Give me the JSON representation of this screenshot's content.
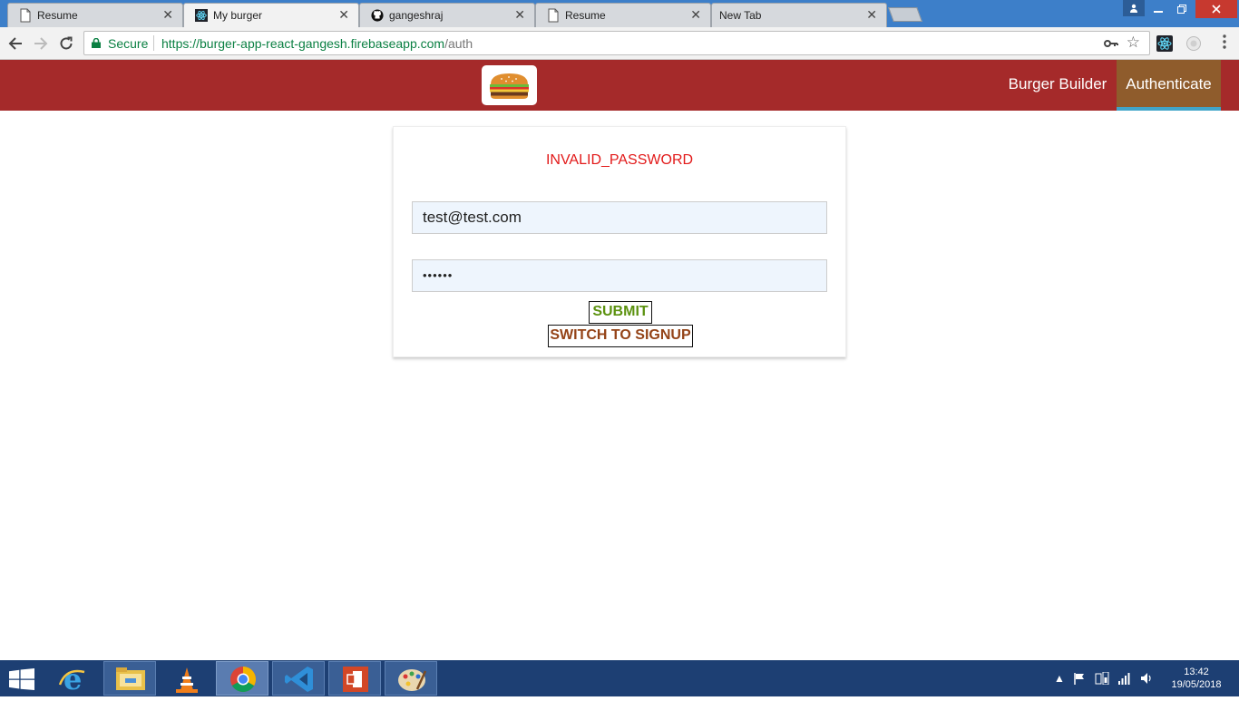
{
  "browser": {
    "tabs": [
      {
        "title": "Resume",
        "icon": "document-icon"
      },
      {
        "title": "My burger",
        "icon": "react-icon"
      },
      {
        "title": "gangeshraj",
        "icon": "github-icon"
      },
      {
        "title": "Resume",
        "icon": "document-icon"
      },
      {
        "title": "New Tab",
        "icon": ""
      }
    ],
    "active_tab": 1,
    "secure_label": "Secure",
    "url_host": "https://burger-app-react-gangesh.firebaseapp.com",
    "url_path": "/auth"
  },
  "app": {
    "nav": {
      "burger_builder": "Burger Builder",
      "authenticate": "Authenticate"
    },
    "colors": {
      "header": "#a52a2a",
      "active_nav": "#8f5c2c",
      "active_indicator": "#40a4c8",
      "error": "#e21a1a",
      "submit": "#5c9210",
      "switch": "#944317"
    }
  },
  "auth": {
    "error": "INVALID_PASSWORD",
    "email_value": "test@test.com",
    "password_value": "••••••",
    "submit_label": "SUBMIT",
    "switch_label": "SWITCH TO SIGNUP"
  },
  "taskbar": {
    "apps": [
      "internet-explorer",
      "file-explorer",
      "vlc",
      "chrome",
      "vscode",
      "office",
      "paint"
    ],
    "time": "13:42",
    "date": "19/05/2018"
  }
}
